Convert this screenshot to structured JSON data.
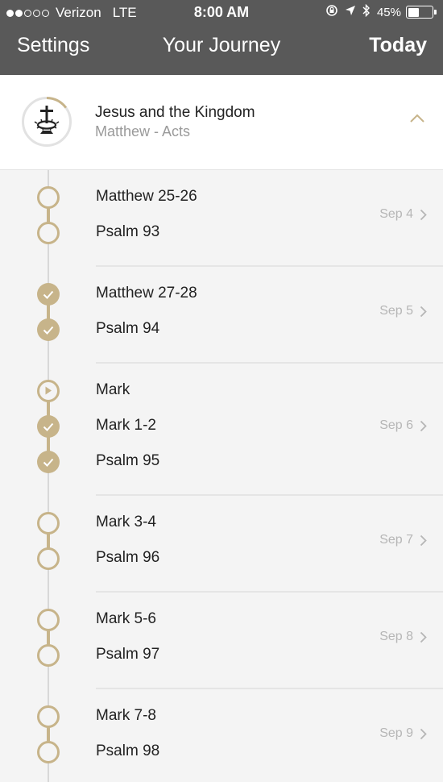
{
  "status_bar": {
    "carrier": "Verizon",
    "network": "LTE",
    "time": "8:00 AM",
    "battery": "45%",
    "battery_level": 0.45,
    "signal_bars_filled": 2,
    "signal_bars_total": 5
  },
  "nav": {
    "left": "Settings",
    "title": "Your Journey",
    "right": "Today"
  },
  "plan": {
    "title": "Jesus and the Kingdom",
    "subtitle": "Matthew - Acts",
    "progress": 0.15
  },
  "colors": {
    "accent": "#c7b48a",
    "navbar": "#595959"
  },
  "days": [
    {
      "date": "Sep 4",
      "items": [
        {
          "label": "Matthew 25-26",
          "state": "open"
        },
        {
          "label": "Psalm 93",
          "state": "open"
        }
      ]
    },
    {
      "date": "Sep 5",
      "items": [
        {
          "label": "Matthew 27-28",
          "state": "done"
        },
        {
          "label": "Psalm 94",
          "state": "done"
        }
      ]
    },
    {
      "date": "Sep 6",
      "items": [
        {
          "label": "Mark",
          "state": "video"
        },
        {
          "label": "Mark 1-2",
          "state": "done"
        },
        {
          "label": "Psalm 95",
          "state": "done"
        }
      ]
    },
    {
      "date": "Sep 7",
      "items": [
        {
          "label": "Mark 3-4",
          "state": "open"
        },
        {
          "label": "Psalm 96",
          "state": "open"
        }
      ]
    },
    {
      "date": "Sep 8",
      "items": [
        {
          "label": "Mark 5-6",
          "state": "open"
        },
        {
          "label": "Psalm 97",
          "state": "open"
        }
      ]
    },
    {
      "date": "Sep 9",
      "items": [
        {
          "label": "Mark 7-8",
          "state": "open"
        },
        {
          "label": "Psalm 98",
          "state": "open"
        }
      ]
    }
  ]
}
